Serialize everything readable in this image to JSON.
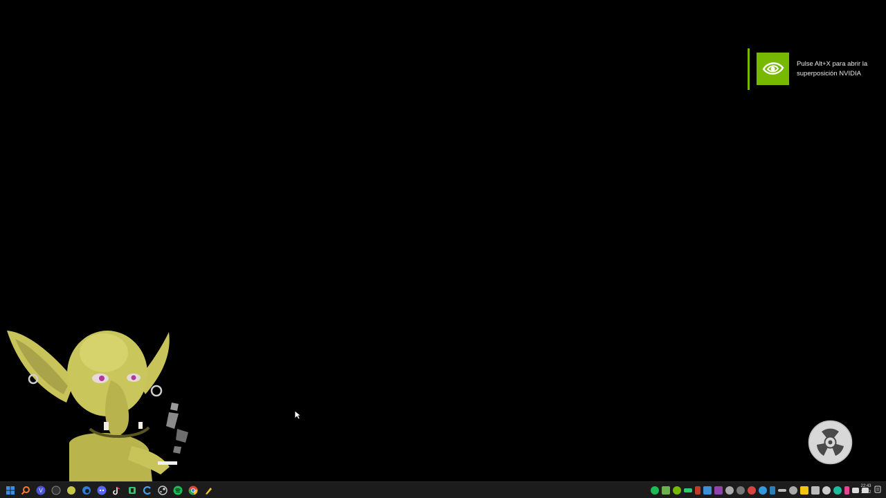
{
  "nvidia_toast": {
    "text": "Pulse Alt+X para abrir la superposición NVIDIA",
    "brand_color": "#76b900"
  },
  "desktop": {
    "mascot": "goblin-character",
    "widget": "film-reel-widget"
  },
  "taskbar": {
    "pinned_icons": [
      {
        "name": "windows-start-icon",
        "color": "#3a8ee6"
      },
      {
        "name": "search-icon",
        "color": "#ff7a2f"
      },
      {
        "name": "vpn-app-icon",
        "color": "#4a56d6"
      },
      {
        "name": "overwolf-icon",
        "color": "#888888"
      },
      {
        "name": "goblin-app-icon",
        "color": "#c7c54a"
      },
      {
        "name": "edge-icon",
        "color": "#2b7fd8"
      },
      {
        "name": "discord-icon",
        "color": "#5865f2"
      },
      {
        "name": "tiktok-icon",
        "color": "#ffffff"
      },
      {
        "name": "phone-link-icon",
        "color": "#3fbf6f"
      },
      {
        "name": "ccleaner-icon",
        "color": "#4aa0e6"
      },
      {
        "name": "steam-icon",
        "color": "#cccccc"
      },
      {
        "name": "spotify-icon",
        "color": "#1db954"
      },
      {
        "name": "chrome-icon",
        "color": "#e5443a"
      },
      {
        "name": "pen-app-icon",
        "color": "#f2c230"
      }
    ],
    "tray_icons": [
      {
        "name": "spotify-tray-icon",
        "color": "#1db954"
      },
      {
        "name": "app-tray-icon",
        "color": "#6ab04c"
      },
      {
        "name": "nvidia-tray-icon",
        "color": "#76b900"
      },
      {
        "name": "battery-tray-icon",
        "color": "#2ecc71"
      },
      {
        "name": "red-tray-icon",
        "color": "#c0392b"
      },
      {
        "name": "puzzle-tray-icon",
        "color": "#3f8fd6"
      },
      {
        "name": "controller-tray-icon",
        "color": "#8e44ad"
      },
      {
        "name": "steam-tray-icon",
        "color": "#aaaaaa"
      },
      {
        "name": "obs-tray-icon",
        "color": "#777777"
      },
      {
        "name": "shield-tray-icon",
        "color": "#d64541"
      },
      {
        "name": "bluetooth-tray-icon",
        "color": "#3498db"
      },
      {
        "name": "pen-tray-icon",
        "color": "#2980b9"
      },
      {
        "name": "arrows-tray-icon",
        "color": "#bbbbbb"
      },
      {
        "name": "gear-tray-icon",
        "color": "#aaaaaa"
      },
      {
        "name": "folder-tray-icon",
        "color": "#f1c40f"
      },
      {
        "name": "window-tray-icon",
        "color": "#bbbbbb"
      },
      {
        "name": "network-tray-icon",
        "color": "#cccccc"
      },
      {
        "name": "steam-mini-tray-icon",
        "color": "#1abc9c"
      },
      {
        "name": "mic-tray-icon",
        "color": "#e84393"
      },
      {
        "name": "wifi-icon",
        "color": "#dddddd"
      },
      {
        "name": "volume-icon",
        "color": "#dddddd"
      }
    ],
    "time": "22:43",
    "date": "17/12"
  }
}
